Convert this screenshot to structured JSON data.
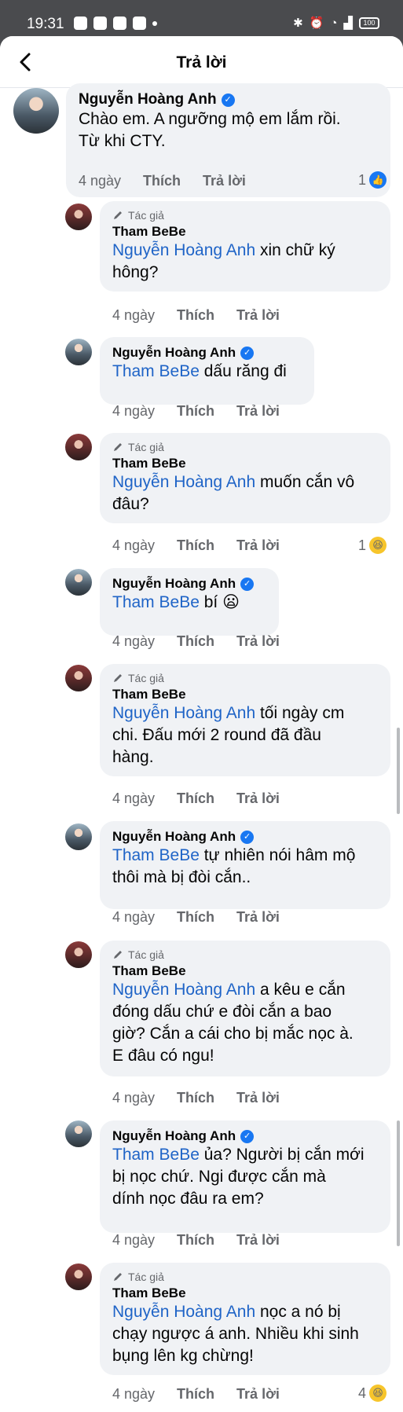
{
  "status_bar": {
    "time": "19:31",
    "battery": "100"
  },
  "header": {
    "title": "Trả lời"
  },
  "labels": {
    "like": "Thích",
    "reply": "Trả lời",
    "author_badge": "Tác giả"
  },
  "comments": [
    {
      "author": "Nguyễn Hoàng Anh",
      "verified": true,
      "mention": "",
      "text": "Chào em. A ngưỡng mộ em lắm rồi. Từ khi CTY.",
      "line1": "Chào em. A ngưỡng mộ em lắm rồi.",
      "line2": "Từ khi CTY.",
      "time": "4 ngày",
      "reaction_count": "1",
      "reaction": "like"
    },
    {
      "author": "Tham BeBe",
      "is_author": true,
      "mention": "Nguyễn Hoàng Anh",
      "text": " xin chữ ký hông?",
      "line1_rest": " xin chữ ký",
      "line2": "hông?",
      "time": "4 ngày"
    },
    {
      "author": "Nguyễn Hoàng Anh",
      "verified": true,
      "mention": "Tham BeBe",
      "text": " dấu răng đi",
      "time": "4 ngày"
    },
    {
      "author": "Tham BeBe",
      "is_author": true,
      "mention": "Nguyễn Hoàng Anh",
      "line1_rest": " muốn cắn vô",
      "line2": "đâu?",
      "time": "4 ngày",
      "reaction_count": "1",
      "reaction": "haha"
    },
    {
      "author": "Nguyễn Hoàng Anh",
      "verified": true,
      "mention": "Tham BeBe",
      "text": " bí",
      "emoji": "😦",
      "time": "4 ngày"
    },
    {
      "author": "Tham BeBe",
      "is_author": true,
      "mention": "Nguyễn Hoàng Anh",
      "line1_rest": " tối ngày cm",
      "line2": "chi. Đấu mới 2 round đã đầu",
      "line3": "hàng.",
      "time": "4 ngày"
    },
    {
      "author": "Nguyễn Hoàng Anh",
      "verified": true,
      "mention": "Tham BeBe",
      "line1_rest": " tự nhiên nói hâm mộ",
      "line2": "thôi mà bị đòi cắn..",
      "time": "4 ngày"
    },
    {
      "author": "Tham BeBe",
      "is_author": true,
      "mention": "Nguyễn Hoàng Anh",
      "line1_rest": " a kêu e cắn",
      "line2": "đóng dấu chứ e đòi cắn a bao",
      "line3": "giờ? Cắn a cái cho bị mắc nọc à.",
      "line4": "E đâu có ngu!",
      "time": "4 ngày"
    },
    {
      "author": "Nguyễn Hoàng Anh",
      "verified": true,
      "mention": "Tham BeBe",
      "line1_rest": " ủa? Người bị cắn mới",
      "line2": "bị nọc chứ. Ngi được cắn mà",
      "line3": "dính nọc đâu ra em?",
      "time": "4 ngày"
    },
    {
      "author": "Tham BeBe",
      "is_author": true,
      "mention": "Nguyễn Hoàng Anh",
      "line1_rest": " nọc a nó bị",
      "line2": "chạy ngược á anh. Nhiều khi sinh",
      "line3": "bụng lên kg chừng!",
      "time": "4 ngày",
      "reaction_count": "4",
      "reaction": "haha"
    }
  ]
}
